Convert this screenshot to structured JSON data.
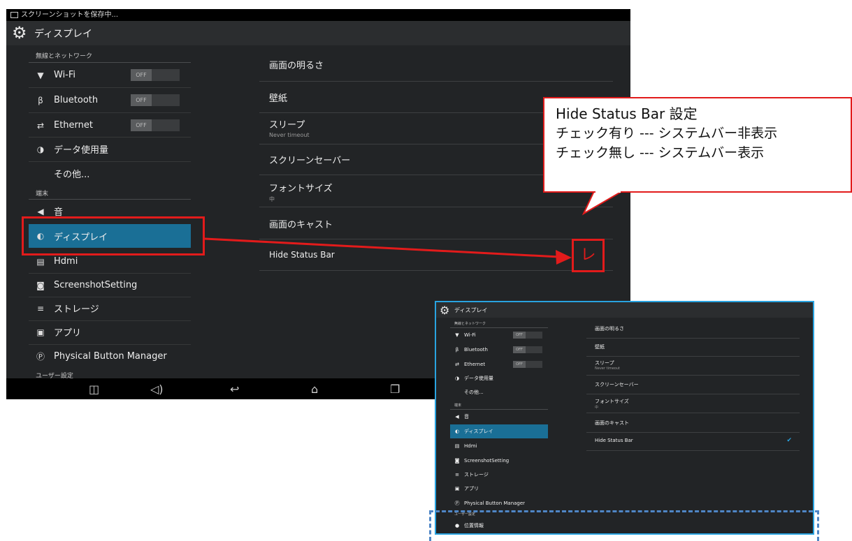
{
  "status_bar": {
    "text": "スクリーンショットを保存中..."
  },
  "action_bar": {
    "title": "ディスプレイ",
    "icon": "gear-icon"
  },
  "sidebar": {
    "cat_wireless": "無線とネットワーク",
    "cat_device": "端末",
    "cat_user": "ユーザー設定",
    "items": [
      {
        "label": "Wi-Fi",
        "icon": "wifi-icon",
        "toggle": "OFF"
      },
      {
        "label": "Bluetooth",
        "icon": "bluetooth-icon",
        "toggle": "OFF"
      },
      {
        "label": "Ethernet",
        "icon": "ethernet-icon",
        "toggle": "OFF"
      },
      {
        "label": "データ使用量",
        "icon": "data-usage-icon"
      },
      {
        "label": "その他..."
      },
      {
        "label": "音",
        "icon": "sound-icon"
      },
      {
        "label": "ディスプレイ",
        "icon": "display-icon",
        "selected": true
      },
      {
        "label": "Hdmi",
        "icon": "hdmi-icon"
      },
      {
        "label": "ScreenshotSetting",
        "icon": "camera-icon"
      },
      {
        "label": "ストレージ",
        "icon": "storage-icon"
      },
      {
        "label": "アプリ",
        "icon": "apps-icon"
      },
      {
        "label": "Physical Button Manager",
        "icon": "button-manager-icon"
      },
      {
        "label": "位置情報",
        "icon": "location-icon"
      }
    ]
  },
  "prefs": [
    {
      "title": "画面の明るさ"
    },
    {
      "title": "壁紙"
    },
    {
      "title": "スリープ",
      "summary": "Never timeout"
    },
    {
      "title": "スクリーンセーバー"
    },
    {
      "title": "フォントサイズ",
      "summary": "中"
    },
    {
      "title": "画面のキャスト"
    },
    {
      "title": "Hide Status Bar"
    }
  ],
  "nav_bar": [
    "screenshot-icon",
    "volume-icon",
    "back-icon",
    "home-icon",
    "recents-icon"
  ],
  "callout": {
    "line1": "Hide Status Bar  設定",
    "line2": "チェック有り  ---  システムバー非表示",
    "line3": "チェック無し  ---  システムバー表示"
  },
  "checkbox_mark": "レ",
  "colors": {
    "accent": "#1a6f96",
    "annotation": "#e21b1b",
    "inset_border": "#29a3e0",
    "dash": "#4f86c6"
  }
}
